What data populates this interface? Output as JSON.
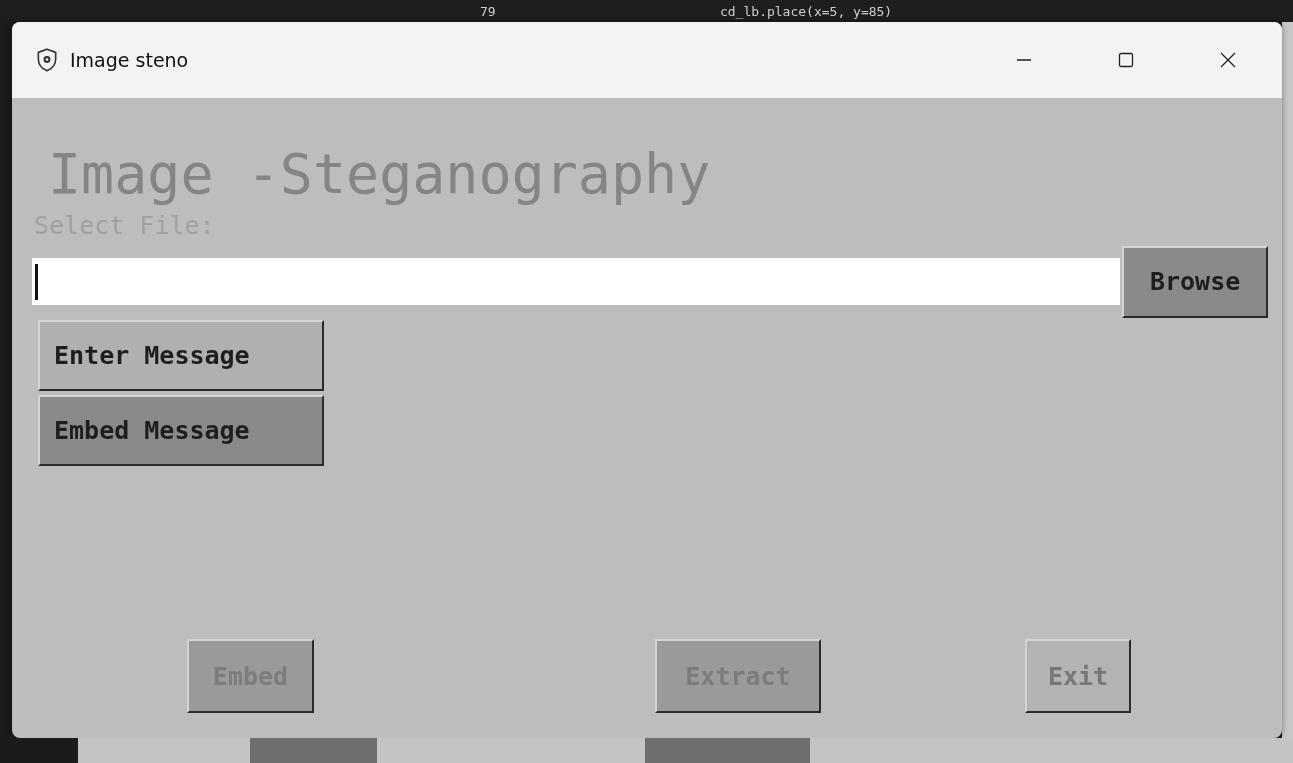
{
  "background": {
    "line_number": "79",
    "code_line": "cd_lb.place(x=5, y=85)"
  },
  "window": {
    "title": "Image steno"
  },
  "heading": "Image -Steganography",
  "file_label": "Select File:",
  "file_field": {
    "focused": true
  },
  "browse_button": {
    "label": "Browse"
  },
  "message_buttons": [
    {
      "label": "Enter Message",
      "kind": "light"
    },
    {
      "label": "Embed Message",
      "kind": "dark"
    }
  ],
  "action_buttons": [
    {
      "label": "Embed",
      "disabled": true
    },
    {
      "label": "Extract",
      "disabled": true
    },
    {
      "label": "Exit",
      "disabled": true
    }
  ]
}
